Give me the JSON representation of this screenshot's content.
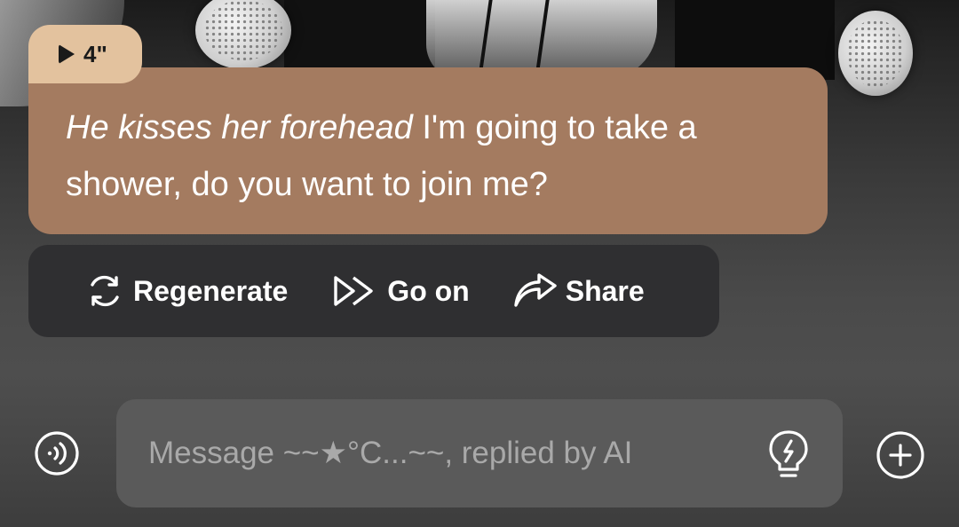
{
  "audio": {
    "duration_label": "4\""
  },
  "message": {
    "action_text": "He kisses her forehead",
    "speech_text": " I'm going to take a shower, do you want to join me?"
  },
  "actions": {
    "regenerate_label": "Regenerate",
    "go_on_label": "Go on",
    "share_label": "Share"
  },
  "composer": {
    "placeholder": "Message ~~★°C...~~, replied by AI",
    "value": ""
  },
  "icons": {
    "voice": "voice-input-icon",
    "bulb": "lightbulb-icon",
    "plus": "plus-icon",
    "regenerate": "refresh-icon",
    "go_on": "fast-forward-icon",
    "share": "share-arrow-icon",
    "play": "play-icon"
  },
  "colors": {
    "bubble": "#a47b60",
    "audio_tag": "#e3c29e",
    "actions_bar": "#2f2f31",
    "input_box": "#5a5a5a"
  }
}
